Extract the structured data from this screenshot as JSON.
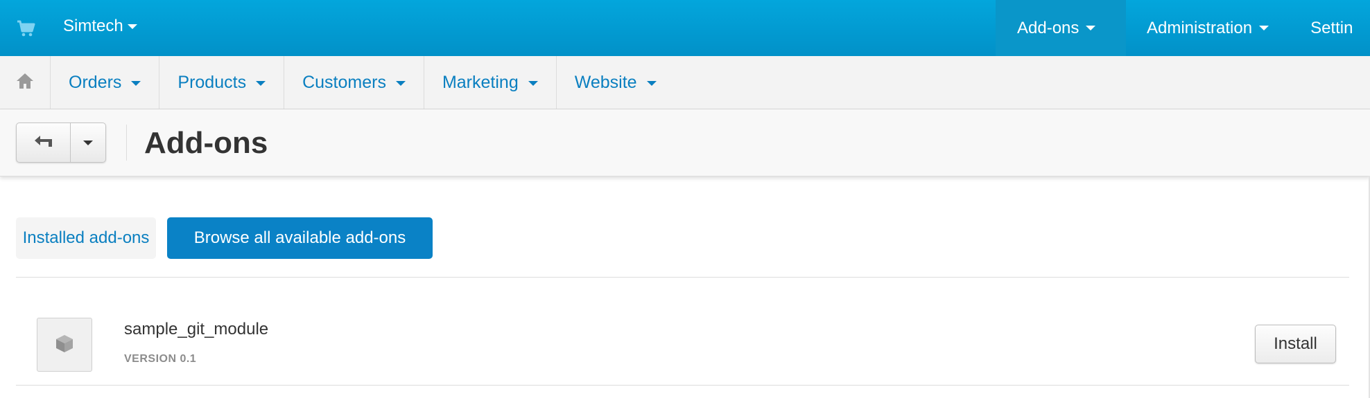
{
  "colors": {
    "topbar": "#0399d3",
    "accent": "#0a82c6",
    "link": "#0a7fc0"
  },
  "topbar": {
    "logo_icon": "cart-icon",
    "brand": "Simtech",
    "items": [
      {
        "label": "Add-ons",
        "active": true
      },
      {
        "label": "Administration",
        "active": false
      },
      {
        "label": "Settin",
        "active": false
      }
    ]
  },
  "navbar": {
    "home_icon": "home-icon",
    "items": [
      {
        "label": "Orders"
      },
      {
        "label": "Products"
      },
      {
        "label": "Customers"
      },
      {
        "label": "Marketing"
      },
      {
        "label": "Website"
      }
    ]
  },
  "header": {
    "back_icon": "back-arrow-icon",
    "dropdown_icon": "caret-down-icon",
    "title": "Add-ons"
  },
  "tabs": [
    {
      "label": "Installed add-ons",
      "active": false
    },
    {
      "label": "Browse all available add-ons",
      "active": true
    }
  ],
  "addons": [
    {
      "icon": "package-icon",
      "name": "sample_git_module",
      "version": "VERSION 0.1",
      "action_label": "Install"
    }
  ]
}
